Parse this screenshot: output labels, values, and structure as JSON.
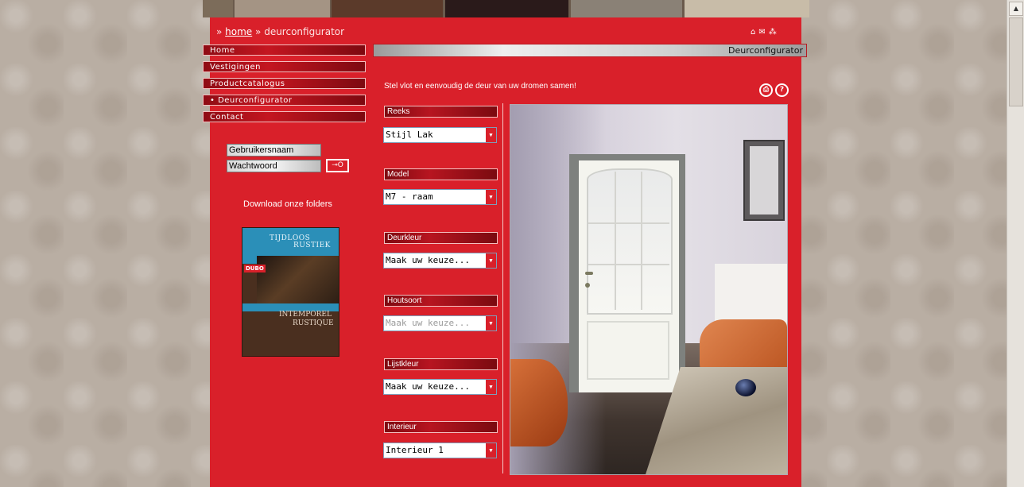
{
  "breadcrumb": {
    "prefix": "»",
    "home_link": "home",
    "separator": "»",
    "current": "deurconfigurator"
  },
  "top_icons": [
    "home-icon",
    "mail-icon",
    "sitemap-icon"
  ],
  "nav": {
    "items": [
      {
        "label": "Home"
      },
      {
        "label": "Vestigingen"
      },
      {
        "label": "Productcatalogus"
      },
      {
        "label": "• Deurconfigurator"
      },
      {
        "label": "Contact"
      }
    ]
  },
  "header": {
    "title": "Deurconfigurator"
  },
  "login": {
    "username_placeholder": "Gebruikersnaam",
    "password_placeholder": "Wachtwoord",
    "submit_icon": "key-icon"
  },
  "folders": {
    "label": "Download onze folders",
    "cover": {
      "title_line1": "TIJDLOOS",
      "title_line2": "RUSTIEK",
      "brand": "DUBO",
      "bottom_line1": "INTEMPOREL",
      "bottom_line2": "RUSTIQUE"
    }
  },
  "intro": {
    "text": "Stel vlot en eenvoudig de deur van uw dromen samen!"
  },
  "help_icons": [
    "print-icon",
    "help-icon"
  ],
  "configurator": [
    {
      "label": "Reeks",
      "value": "Stijl Lak",
      "disabled": false
    },
    {
      "label": "Model",
      "value": "M7 - raam",
      "disabled": false
    },
    {
      "label": "Deurkleur",
      "value": "Maak uw keuze...",
      "disabled": false
    },
    {
      "label": "Houtsoort",
      "value": "Maak uw keuze...",
      "disabled": true
    },
    {
      "label": "Lijstkleur",
      "value": "Maak uw keuze...",
      "disabled": false
    },
    {
      "label": "Interieur",
      "value": "Interieur 1",
      "disabled": false
    }
  ],
  "colors": {
    "brand_red": "#d9202a",
    "nav_dark_red": "#8e0c14",
    "text_white": "#ffffff"
  }
}
